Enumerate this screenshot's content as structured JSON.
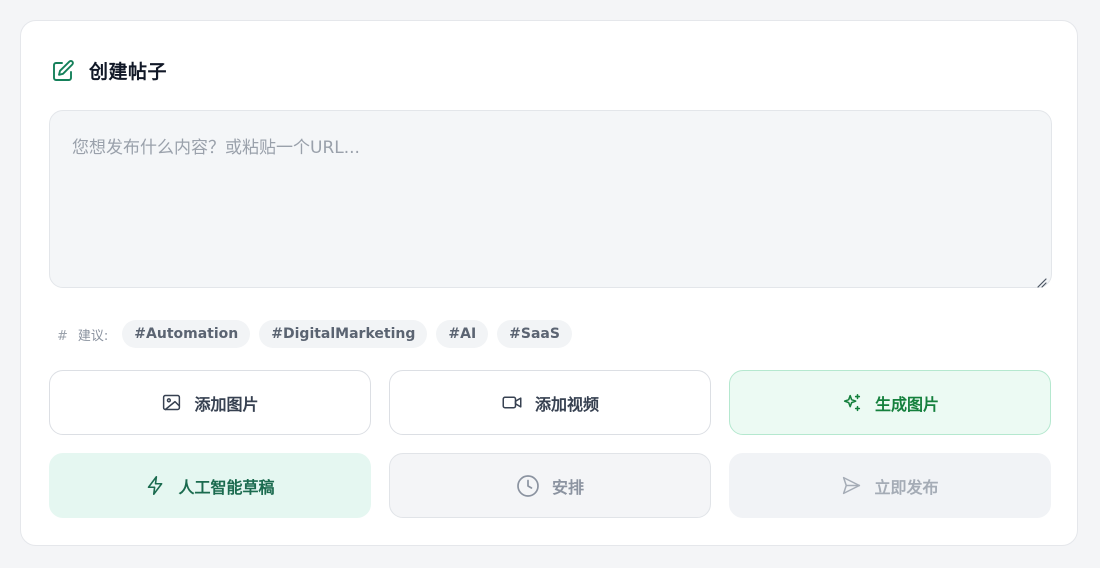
{
  "header": {
    "title": "创建帖子",
    "icon": "edit-icon",
    "accent": "#15805a"
  },
  "composer": {
    "placeholder": "您想发布什么内容？或粘贴一个URL...",
    "value": ""
  },
  "suggestions": {
    "icon": "hash-icon",
    "icon_glyph": "#",
    "label": "建议:",
    "tags": [
      "#Automation",
      "#DigitalMarketing",
      "#AI",
      "#SaaS"
    ]
  },
  "actions": {
    "add_image": {
      "label": "添加图片",
      "icon": "image-icon"
    },
    "add_video": {
      "label": "添加视频",
      "icon": "video-icon"
    },
    "generate_image": {
      "label": "生成图片",
      "icon": "sparkles-icon"
    },
    "ai_draft": {
      "label": "人工智能草稿",
      "icon": "lightning-icon"
    },
    "schedule": {
      "label": "安排",
      "icon": "clock-icon"
    },
    "publish_now": {
      "label": "立即发布",
      "icon": "send-icon"
    }
  },
  "colors": {
    "brand_green": "#15803d",
    "ai_draft_bg": "#e5f7f1",
    "generate_bg": "#ecfaf3"
  }
}
